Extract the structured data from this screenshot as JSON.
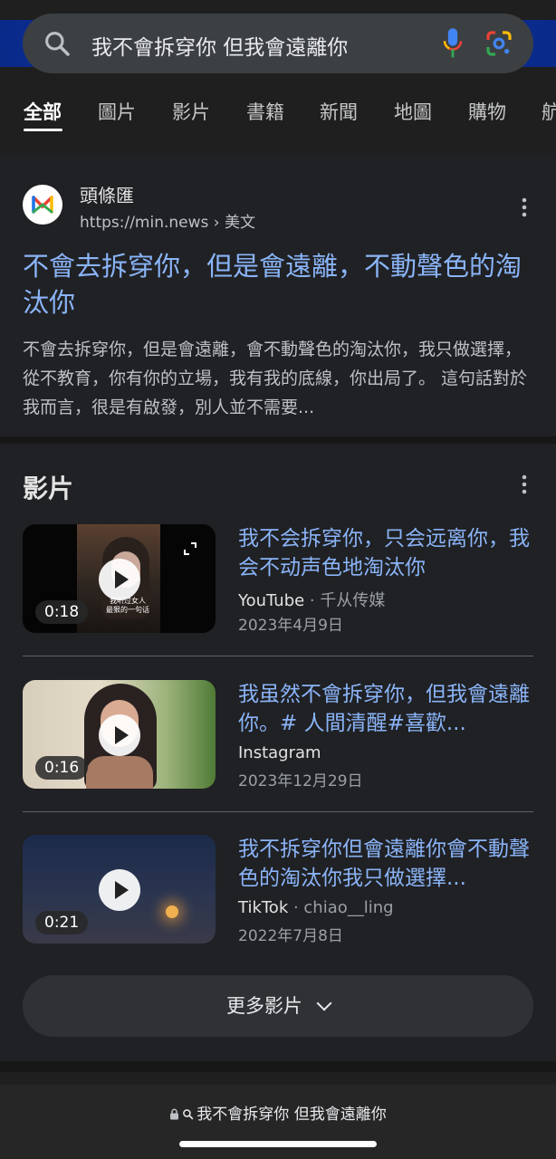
{
  "search": {
    "query": "我不會拆穿你 但我會遠離你",
    "icons": [
      "search-icon",
      "mic-icon",
      "google-lens-icon"
    ]
  },
  "tabs": [
    {
      "label": "全部",
      "active": true
    },
    {
      "label": "圖片"
    },
    {
      "label": "影片"
    },
    {
      "label": "書籍"
    },
    {
      "label": "新聞"
    },
    {
      "label": "地圖"
    },
    {
      "label": "購物"
    },
    {
      "label": "航"
    }
  ],
  "result": {
    "site_name": "頭條匯",
    "url": "https://min.news",
    "url_path": " › 美文",
    "title": "不會去拆穿你，但是會遠離，不動聲色的淘汰你",
    "snippet": "不會去拆穿你，但是會遠離，會不動聲色的淘汰你，我只做選擇，從不教育，你有你的立場，我有我的底線，你出局了。 這句話對於我而言，很是有啟發，別人並不需要..."
  },
  "videos": {
    "heading": "影片",
    "items": [
      {
        "title": "我不会拆穿你，只会远离你，我会不动声色地淘汰你",
        "source": "YouTube",
        "channel": " · 千从传媒",
        "date": "2023年4月9日",
        "duration": "0:18",
        "overlay_text": "我听过女人\n最狠的一句话"
      },
      {
        "title": "我虽然不會拆穿你，但我會遠離你。# 人間清醒#喜歡...",
        "source": "Instagram",
        "channel": "",
        "date": "2023年12月29日",
        "duration": "0:16"
      },
      {
        "title": "我不拆穿你但會遠離你會不動聲色的淘汰你我只做選擇...",
        "source": "TikTok",
        "channel": " · chiao__ling",
        "date": "2022年7月8日",
        "duration": "0:21"
      }
    ],
    "more_label": "更多影片"
  },
  "bottom": {
    "address": "我不會拆穿你 但我會遠離你"
  },
  "colors": {
    "background": "#1f1f1f",
    "link": "#8ab4f8",
    "search_bar": "#3c4043",
    "accent_band": "#10359f"
  }
}
